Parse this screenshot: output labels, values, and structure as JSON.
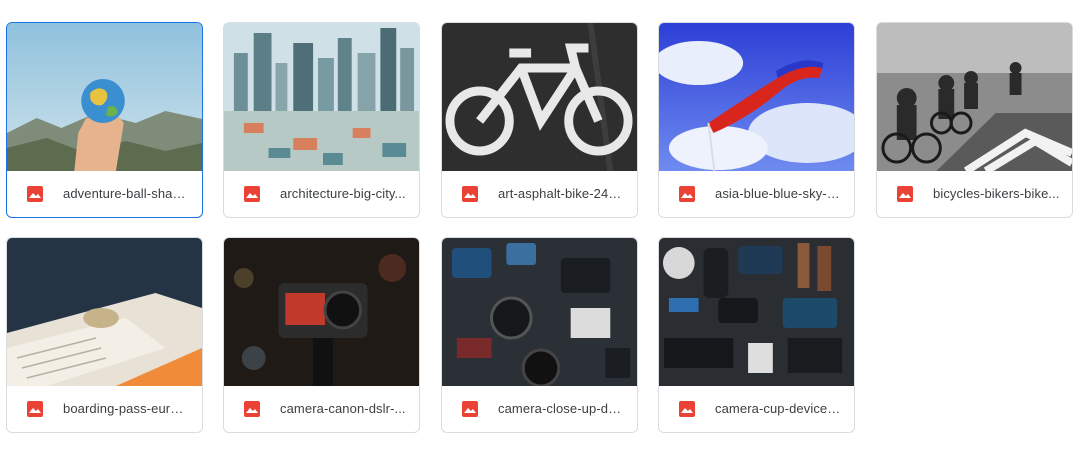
{
  "files": [
    {
      "name": "adventure-ball-shap...",
      "icon": "image-file-icon",
      "selected": true
    },
    {
      "name": "architecture-big-city...",
      "icon": "image-file-icon",
      "selected": false
    },
    {
      "name": "art-asphalt-bike-248...",
      "icon": "image-file-icon",
      "selected": false
    },
    {
      "name": "asia-blue-blue-sky-9...",
      "icon": "image-file-icon",
      "selected": false
    },
    {
      "name": "bicycles-bikers-bike...",
      "icon": "image-file-icon",
      "selected": false
    },
    {
      "name": "boarding-pass-euro-...",
      "icon": "image-file-icon",
      "selected": false
    },
    {
      "name": "camera-canon-dslr-...",
      "icon": "image-file-icon",
      "selected": false
    },
    {
      "name": "camera-close-up-de...",
      "icon": "image-file-icon",
      "selected": false
    },
    {
      "name": "camera-cup-device-...",
      "icon": "image-file-icon",
      "selected": false
    }
  ],
  "colors": {
    "file_icon": "#ea4335",
    "selected_border": "#1a73e8",
    "card_border": "#dadce0",
    "text": "#3c4043"
  }
}
